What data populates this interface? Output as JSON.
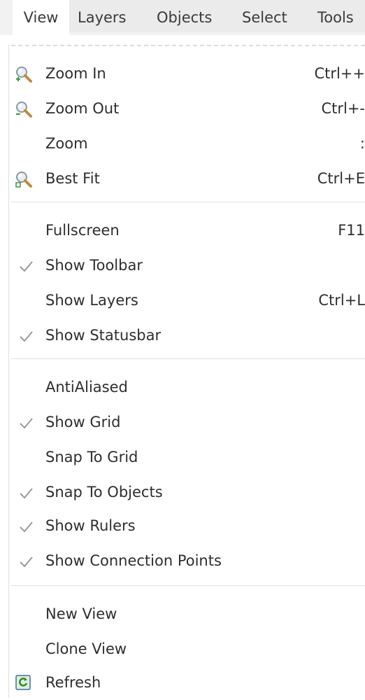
{
  "menubar": {
    "items": [
      {
        "label": "View"
      },
      {
        "label": "Layers"
      },
      {
        "label": "Objects"
      },
      {
        "label": "Select"
      },
      {
        "label": "Tools"
      }
    ]
  },
  "menu": {
    "items": [
      {
        "label": "Zoom In",
        "shortcut": "Ctrl++",
        "icon": "zoom-in-icon"
      },
      {
        "label": "Zoom Out",
        "shortcut": "Ctrl+-",
        "icon": "zoom-out-icon"
      },
      {
        "label": "Zoom",
        "shortcut": ":"
      },
      {
        "label": "Best Fit",
        "shortcut": "Ctrl+E",
        "icon": "best-fit-icon"
      },
      {
        "label": "Fullscreen",
        "shortcut": "F11"
      },
      {
        "label": "Show Toolbar",
        "checked": true
      },
      {
        "label": "Show Layers",
        "shortcut": "Ctrl+L"
      },
      {
        "label": "Show Statusbar",
        "checked": true
      },
      {
        "label": "AntiAliased"
      },
      {
        "label": "Show Grid",
        "checked": true
      },
      {
        "label": "Snap To Grid"
      },
      {
        "label": "Snap To Objects",
        "checked": true
      },
      {
        "label": "Show Rulers",
        "checked": true
      },
      {
        "label": "Show Connection Points",
        "checked": true
      },
      {
        "label": "New View"
      },
      {
        "label": "Clone View"
      },
      {
        "label": "Refresh",
        "icon": "refresh-icon"
      }
    ]
  }
}
